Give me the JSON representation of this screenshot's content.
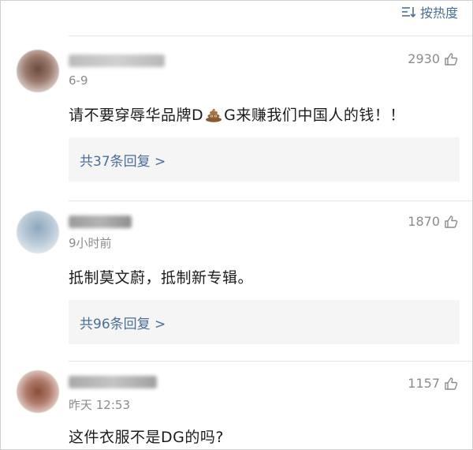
{
  "header": {
    "sort_label": "按热度",
    "sort_icon": "sort-lines-icon"
  },
  "colors": {
    "link": "#4a6e9c",
    "meta": "#8c8c8c",
    "text": "#1c1c1c",
    "reply_bg": "#f5f5f5"
  },
  "comments": [
    {
      "time": "6-9",
      "likes": "2930",
      "text_before": "请不要穿辱华品牌D",
      "text_emoji": "poop-emoji",
      "text_after": "G来赚我们中国人的钱！！",
      "reply_label": "共37条回复 >"
    },
    {
      "time": "9小时前",
      "likes": "1870",
      "text": "抵制莫文蔚，抵制新专辑。",
      "reply_label": "共96条回复 >"
    },
    {
      "time": "昨天 12:53",
      "likes": "1157",
      "text": "这件衣服不是DG的吗?"
    }
  ]
}
